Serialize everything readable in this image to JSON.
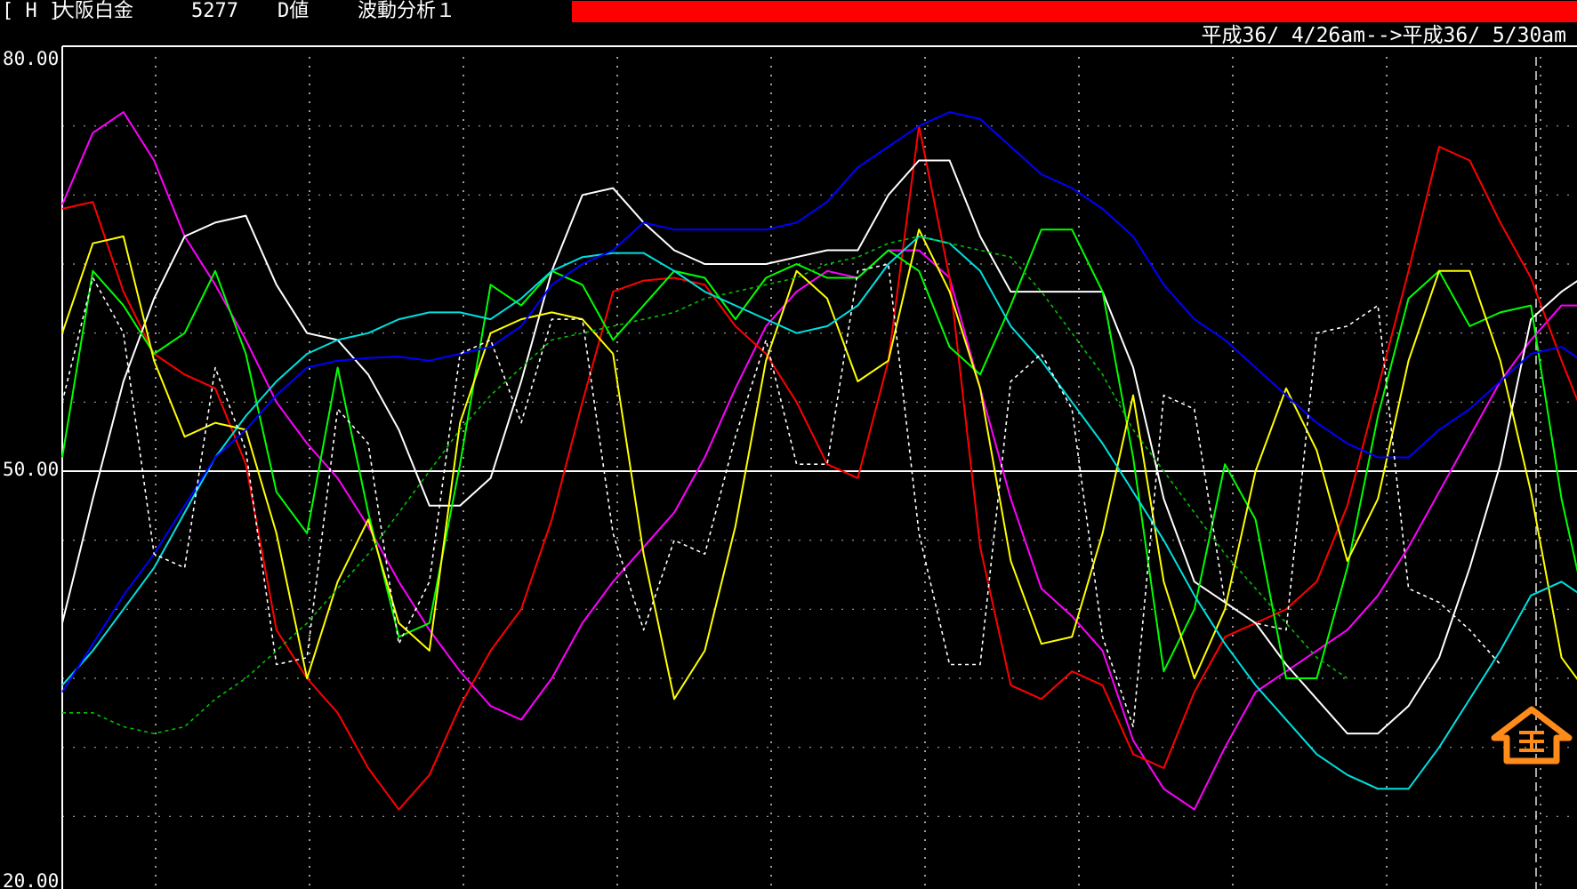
{
  "header": {
    "mode": "[ H ]",
    "instrument": "大阪白金",
    "code": "5277",
    "value_type": "D値",
    "analysis": "波動分析１",
    "date_range": "平成36/ 4/26am-->平成36/ 5/30am"
  },
  "colors": {
    "background": "#000000",
    "status_bar": "#ff0000",
    "marker": "#ff8c1a"
  },
  "icons": {
    "marker": "house-arrow-icon"
  },
  "chart_data": {
    "type": "line",
    "ylim": [
      20,
      80
    ],
    "y_ticks": [
      "80.00",
      "50.00",
      "20.00"
    ],
    "reference_line": 50,
    "grid": true,
    "x": [
      1,
      2,
      3,
      4,
      5,
      6,
      7,
      8,
      9,
      10,
      11,
      12,
      13,
      14,
      15,
      16,
      17,
      18,
      19,
      20,
      21,
      22,
      23,
      24,
      25,
      26,
      27,
      28,
      29,
      30,
      31,
      32,
      33,
      34,
      35,
      36,
      37,
      38,
      39,
      40,
      41,
      42,
      43,
      44,
      45,
      46,
      47,
      48,
      49,
      50
    ],
    "series": [
      {
        "color": "#ff00ff",
        "dashed": false,
        "values": [
          69.3,
          74.5,
          76.0,
          72.5,
          67.0,
          63.5,
          59.5,
          55.0,
          52.0,
          49.5,
          46.0,
          42.0,
          38.5,
          35.5,
          33.0,
          32.0,
          35.0,
          39.0,
          42.0,
          44.5,
          47.0,
          51.0,
          56.0,
          60.5,
          63.0,
          64.5,
          64.0,
          66.0,
          66.0,
          64.0,
          56.0,
          48.0,
          41.5,
          39.5,
          37.0,
          30.5,
          27.0,
          25.5,
          30.0,
          34.0,
          35.5,
          37.0,
          38.5,
          41.0,
          44.5,
          48.5,
          52.5,
          56.5,
          59.5,
          62.0,
          62.0
        ]
      },
      {
        "color": "#ff0000",
        "dashed": false,
        "values": [
          69.0,
          69.5,
          63.0,
          58.5,
          57.0,
          56.0,
          50.5,
          38.5,
          35.0,
          32.5,
          28.5,
          25.5,
          28.0,
          33.0,
          37.0,
          40.0,
          46.5,
          55.0,
          63.0,
          63.8,
          64.0,
          63.5,
          60.5,
          58.5,
          55.0,
          50.5,
          49.5,
          58.0,
          75.0,
          64.0,
          44.5,
          34.5,
          33.5,
          35.5,
          34.5,
          29.5,
          28.5,
          34.0,
          38.0,
          39.0,
          40.0,
          42.0,
          47.5,
          56.0,
          64.5,
          73.5,
          72.5,
          68.0,
          64.0,
          58.0,
          52.5
        ]
      },
      {
        "color": "#ffffff",
        "dashed": false,
        "values": [
          39.0,
          48.0,
          56.5,
          62.5,
          67.0,
          68.0,
          68.5,
          63.5,
          60.0,
          59.5,
          57.0,
          53.0,
          47.5,
          47.5,
          49.5,
          56.5,
          64.5,
          70.0,
          70.5,
          68.0,
          66.0,
          65.0,
          65.0,
          65.0,
          65.5,
          66.0,
          66.0,
          70.0,
          72.5,
          72.5,
          67.0,
          63.0,
          63.0,
          63.0,
          63.0,
          57.5,
          48.0,
          42.0,
          40.5,
          39.0,
          36.0,
          33.5,
          31.0,
          31.0,
          33.0,
          36.5,
          43.0,
          50.5,
          61.0,
          63.0,
          64.5,
          63.0,
          58.0
        ]
      },
      {
        "color": "#00ff00",
        "dashed": false,
        "values": [
          51.0,
          64.5,
          62.0,
          58.5,
          60.0,
          64.5,
          58.5,
          48.5,
          45.5,
          57.5,
          47.0,
          38.0,
          39.0,
          50.5,
          63.5,
          62.0,
          64.5,
          63.5,
          59.5,
          62.0,
          64.5,
          64.0,
          61.0,
          64.0,
          65.0,
          64.0,
          64.0,
          66.0,
          64.5,
          59.0,
          57.0,
          62.0,
          67.5,
          67.5,
          63.0,
          51.0,
          35.5,
          40.0,
          50.5,
          46.5,
          35.0,
          35.0,
          43.0,
          54.0,
          62.5,
          64.5,
          60.5,
          61.5,
          62.0,
          48.0,
          38.0
        ]
      },
      {
        "color": "#ffff00",
        "dashed": false,
        "values": [
          60.0,
          66.5,
          67.0,
          58.0,
          52.5,
          53.5,
          53.0,
          45.5,
          35.0,
          42.0,
          46.5,
          39.0,
          37.0,
          53.5,
          60.0,
          61.0,
          61.5,
          61.0,
          58.5,
          44.0,
          33.5,
          37.0,
          46.0,
          58.0,
          64.5,
          62.5,
          56.5,
          58.0,
          67.5,
          63.0,
          56.0,
          43.5,
          37.5,
          38.0,
          45.5,
          55.5,
          42.0,
          35.0,
          40.0,
          50.0,
          56.0,
          51.5,
          43.5,
          48.0,
          58.0,
          64.5,
          64.5,
          58.0,
          48.5,
          36.5,
          33.5,
          35.0
        ]
      },
      {
        "color": "#00e0e0",
        "dashed": false,
        "values": [
          34.5,
          37.0,
          40.0,
          43.0,
          47.0,
          51.0,
          54.0,
          56.5,
          58.5,
          59.5,
          60.0,
          61.0,
          61.5,
          61.5,
          61.0,
          62.5,
          64.5,
          65.5,
          65.8,
          65.8,
          64.5,
          63.0,
          62.0,
          61.0,
          60.0,
          60.5,
          62.0,
          65.0,
          67.0,
          66.5,
          64.5,
          60.5,
          58.0,
          55.0,
          52.0,
          48.5,
          45.0,
          41.0,
          37.5,
          34.5,
          32.0,
          29.5,
          28.0,
          27.0,
          27.0,
          30.0,
          33.5,
          37.0,
          41.0,
          42.0,
          40.5,
          39.5
        ]
      },
      {
        "color": "#0000ff",
        "dashed": false,
        "values": [
          34.0,
          37.5,
          41.0,
          44.0,
          47.5,
          51.0,
          53.0,
          55.5,
          57.5,
          58.0,
          58.2,
          58.3,
          58.0,
          58.5,
          59.0,
          60.5,
          63.5,
          65.0,
          66.0,
          68.0,
          67.5,
          67.5,
          67.5,
          67.5,
          68.0,
          69.5,
          72.0,
          73.5,
          75.0,
          76.0,
          75.5,
          73.5,
          71.5,
          70.5,
          69.0,
          67.0,
          63.5,
          61.0,
          59.5,
          57.5,
          55.5,
          53.5,
          52.0,
          51.0,
          51.0,
          53.0,
          54.5,
          56.5,
          58.5,
          59.0,
          57.5,
          55.0
        ]
      },
      {
        "color": "#ffffff",
        "dashed": true,
        "values": [
          55.0,
          64.0,
          60.0,
          44.0,
          43.0,
          57.5,
          51.5,
          36.0,
          36.5,
          54.5,
          52.0,
          37.5,
          42.0,
          58.5,
          59.5,
          53.5,
          61.0,
          61.0,
          45.5,
          38.5,
          45.0,
          44.0,
          52.5,
          59.5,
          50.5,
          50.5,
          64.5,
          65.0,
          45.5,
          36.0,
          36.0,
          56.5,
          58.5,
          54.5,
          38.0,
          31.5,
          55.5,
          54.5,
          40.5,
          39.0,
          38.5,
          60.0,
          60.5,
          62.0,
          41.5,
          40.5,
          38.5,
          36.0
        ]
      },
      {
        "color": "#00c000",
        "dashed": true,
        "values": [
          32.5,
          32.5,
          31.5,
          31.0,
          31.5,
          33.5,
          35.0,
          37.0,
          39.0,
          41.5,
          44.0,
          47.0,
          50.0,
          53.0,
          55.5,
          57.5,
          59.5,
          60.0,
          60.5,
          61.0,
          61.5,
          62.5,
          63.0,
          63.5,
          64.0,
          65.0,
          65.5,
          66.5,
          67.0,
          66.5,
          66.0,
          65.5,
          63.0,
          60.0,
          57.0,
          53.0,
          50.0,
          47.0,
          44.0,
          41.5,
          39.0,
          36.5,
          35.0
        ]
      }
    ]
  }
}
